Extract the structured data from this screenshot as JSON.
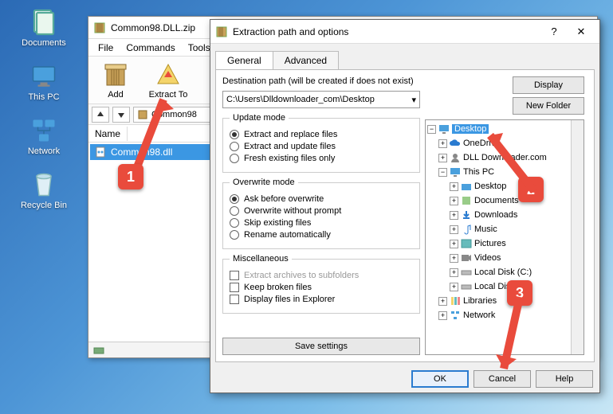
{
  "desktop": {
    "icons": [
      {
        "name": "documents",
        "label": "Documents"
      },
      {
        "name": "thispc",
        "label": "This PC"
      },
      {
        "name": "network",
        "label": "Network"
      },
      {
        "name": "recyclebin",
        "label": "Recycle Bin"
      }
    ]
  },
  "winrar": {
    "title": "Common98.DLL.zip",
    "menu": [
      "File",
      "Commands",
      "Tools"
    ],
    "toolbar": [
      {
        "name": "add",
        "label": "Add"
      },
      {
        "name": "extract",
        "label": "Extract To"
      }
    ],
    "navpath": "Common98",
    "columns": [
      "Name"
    ],
    "rows": [
      {
        "name": "common98.dll",
        "label": "Common98.dll"
      }
    ]
  },
  "dialog": {
    "title": "Extraction path and options",
    "tabs": [
      "General",
      "Advanced"
    ],
    "dest_label": "Destination path (will be created if does not exist)",
    "dest_value": "C:\\Users\\Dlldownloader_com\\Desktop",
    "btn_display": "Display",
    "btn_newfolder": "New Folder",
    "update": {
      "legend": "Update mode",
      "opts": [
        "Extract and replace files",
        "Extract and update files",
        "Fresh existing files only"
      ],
      "selected": 0
    },
    "overwrite": {
      "legend": "Overwrite mode",
      "opts": [
        "Ask before overwrite",
        "Overwrite without prompt",
        "Skip existing files",
        "Rename automatically"
      ],
      "selected": 0
    },
    "misc": {
      "legend": "Miscellaneous",
      "opts": [
        "Extract archives to subfolders",
        "Keep broken files",
        "Display files in Explorer"
      ]
    },
    "save_settings": "Save settings",
    "tree": [
      {
        "lvl": 0,
        "exp": "-",
        "icon": "desktop",
        "label": "Desktop",
        "sel": true
      },
      {
        "lvl": 1,
        "exp": "+",
        "icon": "onedrive",
        "label": "OneDrive"
      },
      {
        "lvl": 1,
        "exp": "+",
        "icon": "user",
        "label": "DLL Downloader.com"
      },
      {
        "lvl": 1,
        "exp": "-",
        "icon": "pc",
        "label": "This PC"
      },
      {
        "lvl": 2,
        "exp": "+",
        "icon": "folder",
        "label": "Desktop"
      },
      {
        "lvl": 2,
        "exp": "+",
        "icon": "folder",
        "label": "Documents"
      },
      {
        "lvl": 2,
        "exp": "+",
        "icon": "folder",
        "label": "Downloads"
      },
      {
        "lvl": 2,
        "exp": "+",
        "icon": "folder",
        "label": "Music"
      },
      {
        "lvl": 2,
        "exp": "+",
        "icon": "folder",
        "label": "Pictures"
      },
      {
        "lvl": 2,
        "exp": "+",
        "icon": "folder",
        "label": "Videos"
      },
      {
        "lvl": 2,
        "exp": "+",
        "icon": "drive",
        "label": "Local Disk (C:)"
      },
      {
        "lvl": 2,
        "exp": "+",
        "icon": "drive",
        "label": "Local Disk (D:)"
      },
      {
        "lvl": 1,
        "exp": "+",
        "icon": "lib",
        "label": "Libraries"
      },
      {
        "lvl": 1,
        "exp": "+",
        "icon": "net",
        "label": "Network"
      }
    ],
    "btn_ok": "OK",
    "btn_cancel": "Cancel",
    "btn_help": "Help"
  },
  "annotations": {
    "c1": "1",
    "c2": "2",
    "c3": "3"
  }
}
